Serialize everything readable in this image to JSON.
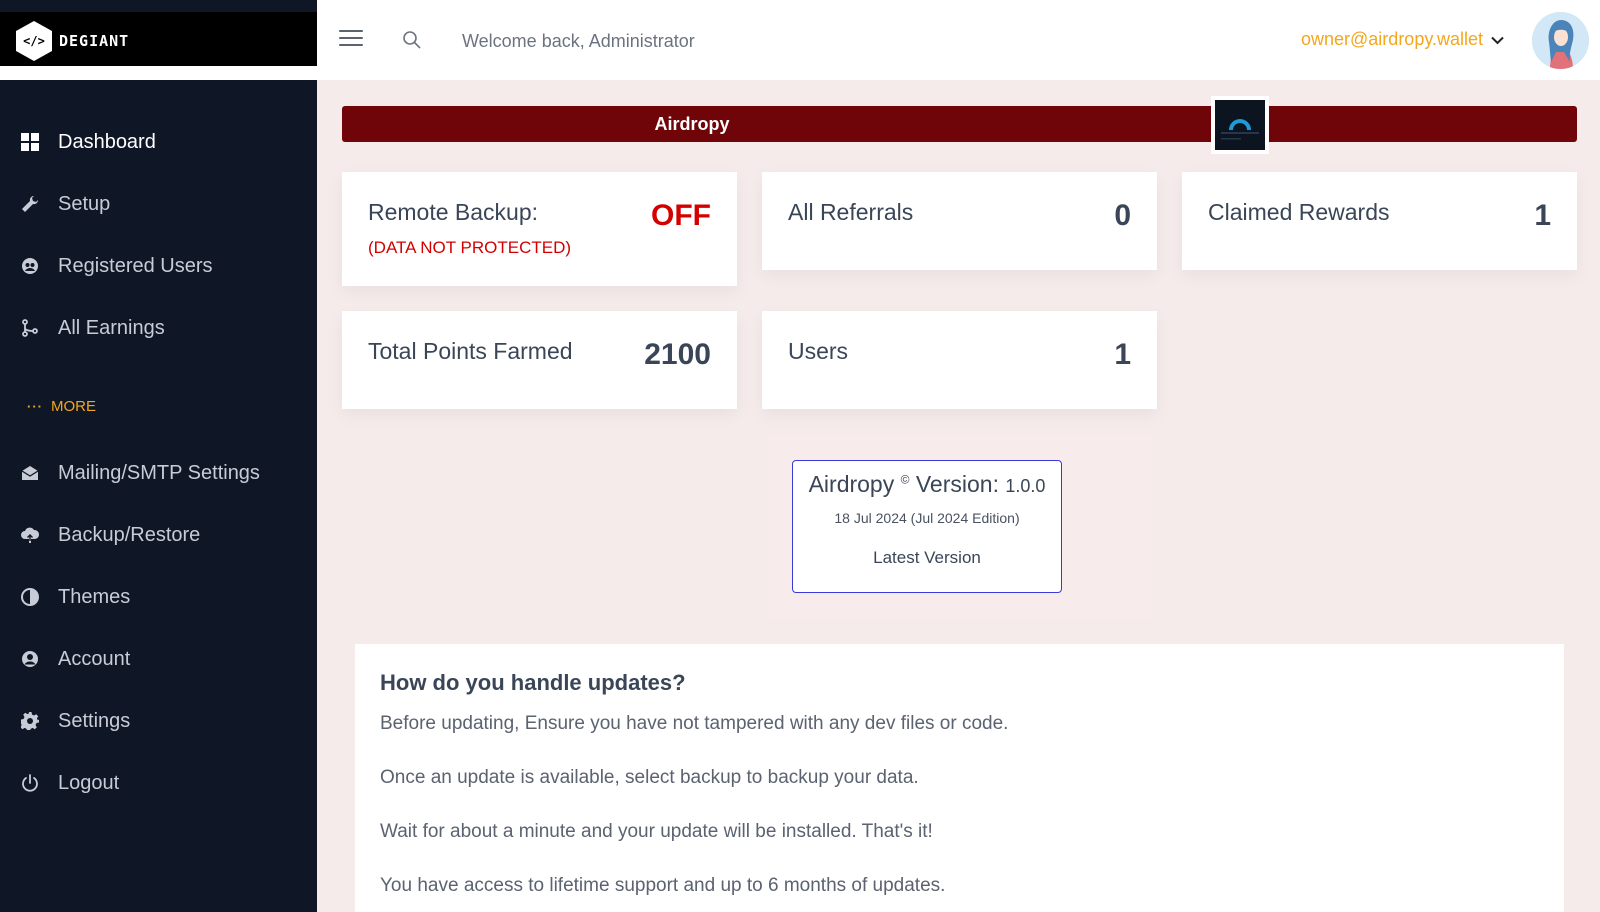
{
  "brand": {
    "logo_text": "DEGIANT",
    "logo_glyph": "</>"
  },
  "sidebar": {
    "items": [
      {
        "label": "Dashboard",
        "icon": "grid-icon",
        "active": true
      },
      {
        "label": "Setup",
        "icon": "wrench-icon"
      },
      {
        "label": "Registered Users",
        "icon": "users-icon"
      },
      {
        "label": "All Earnings",
        "icon": "branch-icon"
      }
    ],
    "more_label": "MORE",
    "more_dots": "···",
    "more_items": [
      {
        "label": "Mailing/SMTP Settings",
        "icon": "envelope-icon"
      },
      {
        "label": "Backup/Restore",
        "icon": "cloud-upload-icon"
      },
      {
        "label": "Themes",
        "icon": "contrast-icon"
      },
      {
        "label": "Account",
        "icon": "user-circle-icon"
      },
      {
        "label": "Settings",
        "icon": "gear-icon"
      },
      {
        "label": "Logout",
        "icon": "power-icon"
      }
    ]
  },
  "header": {
    "welcome": "Welcome back, Administrator",
    "user_email": "owner@airdropy.wallet"
  },
  "banner": {
    "title": "Airdropy"
  },
  "cards": {
    "remote_backup": {
      "title": "Remote Backup:",
      "value": "OFF",
      "subtitle": "(DATA NOT PROTECTED)"
    },
    "all_referrals": {
      "title": "All Referrals",
      "value": "0"
    },
    "claimed_rewards": {
      "title": "Claimed Rewards",
      "value": "1"
    },
    "total_points": {
      "title": "Total Points Farmed",
      "value": "2100"
    },
    "users": {
      "title": "Users",
      "value": "1"
    }
  },
  "version": {
    "name": "Airdropy",
    "copyright": "©",
    "label": "Version:",
    "number": "1.0.0",
    "date": "18 Jul 2024 (Jul 2024 Edition)",
    "status": "Latest Version"
  },
  "updates": {
    "heading": "How do you handle updates?",
    "lines": [
      "Before updating, Ensure you have not tampered with any dev files or code.",
      "Once an update is available, select backup to backup your data.",
      "Wait for about a minute and your update will be installed. That's it!",
      "You have access to lifetime support and up to 6 months of updates."
    ]
  },
  "colors": {
    "accent": "#f3a71c",
    "banner": "#6f0409",
    "sidebar": "#0f1626",
    "alert": "#d40000"
  }
}
